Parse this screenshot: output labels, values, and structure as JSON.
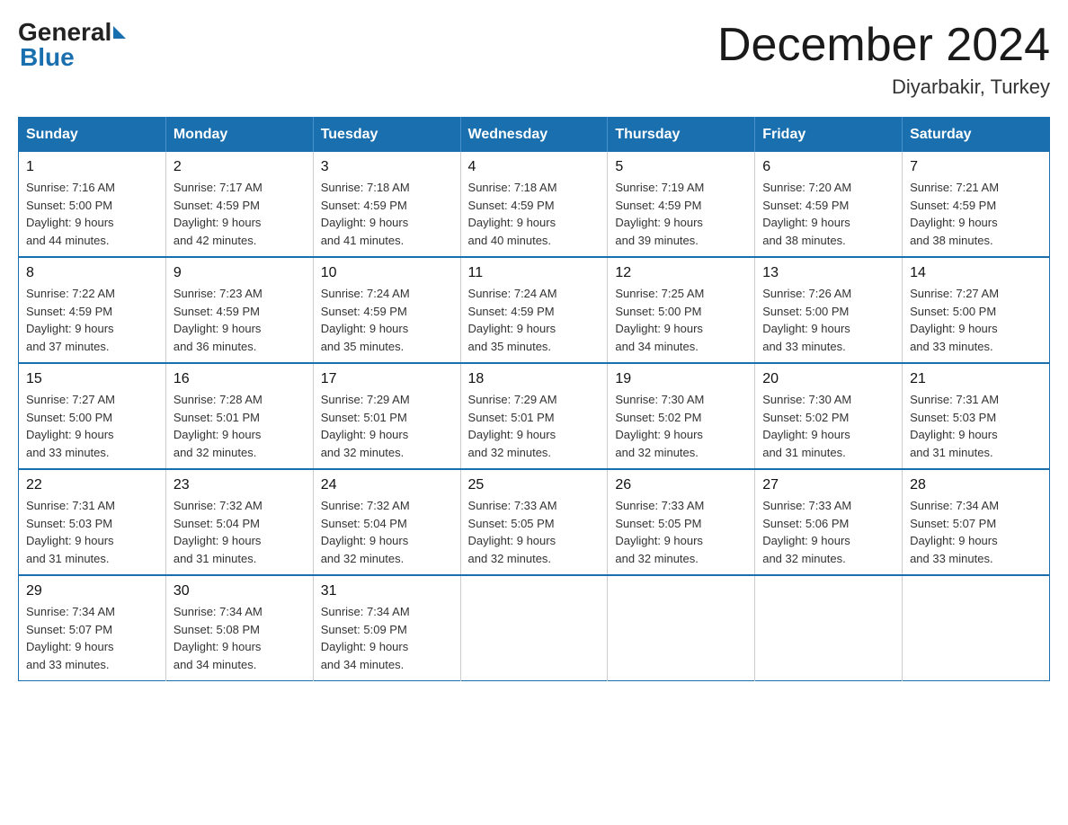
{
  "logo": {
    "general": "General",
    "blue": "Blue"
  },
  "title": {
    "month_year": "December 2024",
    "location": "Diyarbakir, Turkey"
  },
  "days_of_week": [
    "Sunday",
    "Monday",
    "Tuesday",
    "Wednesday",
    "Thursday",
    "Friday",
    "Saturday"
  ],
  "weeks": [
    [
      {
        "day": "1",
        "sunrise": "7:16 AM",
        "sunset": "5:00 PM",
        "daylight": "9 hours and 44 minutes."
      },
      {
        "day": "2",
        "sunrise": "7:17 AM",
        "sunset": "4:59 PM",
        "daylight": "9 hours and 42 minutes."
      },
      {
        "day": "3",
        "sunrise": "7:18 AM",
        "sunset": "4:59 PM",
        "daylight": "9 hours and 41 minutes."
      },
      {
        "day": "4",
        "sunrise": "7:18 AM",
        "sunset": "4:59 PM",
        "daylight": "9 hours and 40 minutes."
      },
      {
        "day": "5",
        "sunrise": "7:19 AM",
        "sunset": "4:59 PM",
        "daylight": "9 hours and 39 minutes."
      },
      {
        "day": "6",
        "sunrise": "7:20 AM",
        "sunset": "4:59 PM",
        "daylight": "9 hours and 38 minutes."
      },
      {
        "day": "7",
        "sunrise": "7:21 AM",
        "sunset": "4:59 PM",
        "daylight": "9 hours and 38 minutes."
      }
    ],
    [
      {
        "day": "8",
        "sunrise": "7:22 AM",
        "sunset": "4:59 PM",
        "daylight": "9 hours and 37 minutes."
      },
      {
        "day": "9",
        "sunrise": "7:23 AM",
        "sunset": "4:59 PM",
        "daylight": "9 hours and 36 minutes."
      },
      {
        "day": "10",
        "sunrise": "7:24 AM",
        "sunset": "4:59 PM",
        "daylight": "9 hours and 35 minutes."
      },
      {
        "day": "11",
        "sunrise": "7:24 AM",
        "sunset": "4:59 PM",
        "daylight": "9 hours and 35 minutes."
      },
      {
        "day": "12",
        "sunrise": "7:25 AM",
        "sunset": "5:00 PM",
        "daylight": "9 hours and 34 minutes."
      },
      {
        "day": "13",
        "sunrise": "7:26 AM",
        "sunset": "5:00 PM",
        "daylight": "9 hours and 33 minutes."
      },
      {
        "day": "14",
        "sunrise": "7:27 AM",
        "sunset": "5:00 PM",
        "daylight": "9 hours and 33 minutes."
      }
    ],
    [
      {
        "day": "15",
        "sunrise": "7:27 AM",
        "sunset": "5:00 PM",
        "daylight": "9 hours and 33 minutes."
      },
      {
        "day": "16",
        "sunrise": "7:28 AM",
        "sunset": "5:01 PM",
        "daylight": "9 hours and 32 minutes."
      },
      {
        "day": "17",
        "sunrise": "7:29 AM",
        "sunset": "5:01 PM",
        "daylight": "9 hours and 32 minutes."
      },
      {
        "day": "18",
        "sunrise": "7:29 AM",
        "sunset": "5:01 PM",
        "daylight": "9 hours and 32 minutes."
      },
      {
        "day": "19",
        "sunrise": "7:30 AM",
        "sunset": "5:02 PM",
        "daylight": "9 hours and 32 minutes."
      },
      {
        "day": "20",
        "sunrise": "7:30 AM",
        "sunset": "5:02 PM",
        "daylight": "9 hours and 31 minutes."
      },
      {
        "day": "21",
        "sunrise": "7:31 AM",
        "sunset": "5:03 PM",
        "daylight": "9 hours and 31 minutes."
      }
    ],
    [
      {
        "day": "22",
        "sunrise": "7:31 AM",
        "sunset": "5:03 PM",
        "daylight": "9 hours and 31 minutes."
      },
      {
        "day": "23",
        "sunrise": "7:32 AM",
        "sunset": "5:04 PM",
        "daylight": "9 hours and 31 minutes."
      },
      {
        "day": "24",
        "sunrise": "7:32 AM",
        "sunset": "5:04 PM",
        "daylight": "9 hours and 32 minutes."
      },
      {
        "day": "25",
        "sunrise": "7:33 AM",
        "sunset": "5:05 PM",
        "daylight": "9 hours and 32 minutes."
      },
      {
        "day": "26",
        "sunrise": "7:33 AM",
        "sunset": "5:05 PM",
        "daylight": "9 hours and 32 minutes."
      },
      {
        "day": "27",
        "sunrise": "7:33 AM",
        "sunset": "5:06 PM",
        "daylight": "9 hours and 32 minutes."
      },
      {
        "day": "28",
        "sunrise": "7:34 AM",
        "sunset": "5:07 PM",
        "daylight": "9 hours and 33 minutes."
      }
    ],
    [
      {
        "day": "29",
        "sunrise": "7:34 AM",
        "sunset": "5:07 PM",
        "daylight": "9 hours and 33 minutes."
      },
      {
        "day": "30",
        "sunrise": "7:34 AM",
        "sunset": "5:08 PM",
        "daylight": "9 hours and 34 minutes."
      },
      {
        "day": "31",
        "sunrise": "7:34 AM",
        "sunset": "5:09 PM",
        "daylight": "9 hours and 34 minutes."
      },
      null,
      null,
      null,
      null
    ]
  ],
  "labels": {
    "sunrise": "Sunrise:",
    "sunset": "Sunset:",
    "daylight": "Daylight:"
  }
}
